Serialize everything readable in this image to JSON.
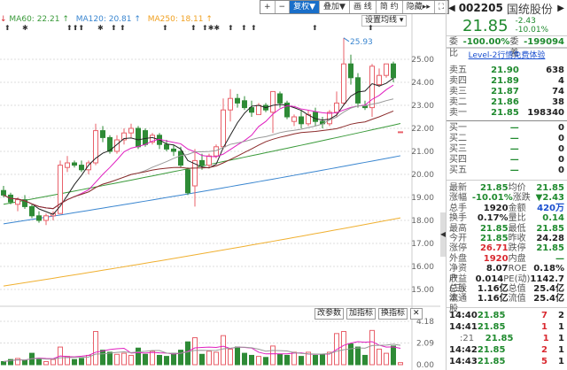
{
  "toolbar": {
    "buttons": [
      "+",
      "−",
      "复权▼",
      "叠加▼",
      "画 线",
      "简 约",
      "隐藏▸▸",
      "⛶"
    ],
    "active": 2
  },
  "ma_legend": [
    {
      "label": "MA60: 22.21 ↑",
      "color": "#3a9a3a"
    },
    {
      "label": "MA120: 20.81 ↑",
      "color": "#3a86d0"
    },
    {
      "label": "MA250: 18.11 ↑",
      "color": "#f0a020"
    }
  ],
  "set_ma_label": "设置均线 ▾",
  "event_markers": [
    "⬆",
    "✱",
    "⬆⬆⬆",
    "✱",
    "⬆",
    "⬆",
    "⬆",
    "⬆",
    "⬆✱✱",
    "⬆",
    "⬆",
    "⬆",
    "⬆",
    "⬆"
  ],
  "indicator_buttons": [
    "改参数",
    "加指标",
    "换指标",
    "✕"
  ],
  "colors": {
    "up": "#e8606a",
    "down": "#2e8b36",
    "ma5": "#222222",
    "ma10": "#e020c0",
    "ma20": "#999999",
    "ma30": "#8b2a2a",
    "ma60": "#3a9a3a",
    "ma120": "#3a86d0",
    "ma250": "#f0b030"
  },
  "chart_data": {
    "type": "candlestick",
    "price_ticks": [
      "25.00",
      "24.00",
      "23.00",
      "22.00",
      "21.00",
      "20.00",
      "19.00",
      "18.00",
      "17.00",
      "16.00",
      "15.00"
    ],
    "volume_ticks": [
      "4.18",
      "2.09",
      "0.00"
    ],
    "high_annotation": "25.93",
    "ohlc": [
      [
        19.3,
        19.5,
        19.0,
        19.1
      ],
      [
        19.1,
        19.2,
        18.7,
        18.8
      ],
      [
        18.7,
        19.0,
        18.4,
        18.9
      ],
      [
        18.9,
        19.1,
        18.5,
        18.6
      ],
      [
        18.6,
        18.7,
        18.1,
        18.2
      ],
      [
        18.2,
        18.4,
        17.9,
        18.0
      ],
      [
        18.0,
        18.3,
        17.8,
        18.2
      ],
      [
        18.2,
        18.4,
        18.0,
        18.3
      ],
      [
        18.3,
        20.6,
        18.3,
        20.4
      ],
      [
        20.3,
        20.8,
        20.1,
        20.5
      ],
      [
        20.5,
        20.6,
        20.3,
        20.4
      ],
      [
        20.4,
        20.6,
        20.1,
        20.2
      ],
      [
        20.2,
        20.6,
        20.0,
        20.5
      ],
      [
        20.5,
        22.2,
        20.4,
        21.9
      ],
      [
        21.9,
        22.1,
        21.4,
        21.6
      ],
      [
        21.6,
        21.7,
        20.9,
        21.0
      ],
      [
        21.0,
        21.7,
        20.9,
        21.5
      ],
      [
        21.5,
        22.0,
        21.3,
        21.8
      ],
      [
        21.8,
        22.2,
        21.6,
        22.0
      ],
      [
        22.0,
        22.1,
        21.1,
        21.2
      ],
      [
        21.9,
        22.0,
        21.2,
        21.3
      ],
      [
        21.4,
        21.8,
        21.3,
        21.7
      ],
      [
        21.7,
        21.8,
        21.1,
        21.3
      ],
      [
        21.3,
        21.5,
        21.0,
        21.1
      ],
      [
        21.1,
        21.3,
        20.8,
        21.0
      ],
      [
        21.0,
        21.2,
        20.3,
        20.4
      ],
      [
        20.2,
        20.3,
        19.1,
        19.2
      ],
      [
        19.5,
        21.1,
        18.6,
        20.6
      ],
      [
        20.6,
        20.9,
        20.2,
        20.4
      ],
      [
        20.4,
        20.9,
        20.3,
        20.8
      ],
      [
        20.8,
        21.3,
        20.7,
        21.2
      ],
      [
        21.2,
        23.3,
        21.1,
        22.8
      ],
      [
        22.8,
        23.7,
        22.3,
        23.3
      ],
      [
        23.3,
        23.5,
        22.9,
        23.1
      ],
      [
        23.2,
        23.4,
        22.8,
        22.9
      ],
      [
        22.9,
        23.2,
        22.5,
        22.7
      ],
      [
        22.6,
        23.1,
        22.6,
        23.0
      ],
      [
        23.0,
        23.1,
        22.7,
        22.8
      ],
      [
        22.7,
        23.6,
        21.8,
        23.6
      ],
      [
        23.5,
        23.6,
        22.9,
        23.1
      ],
      [
        23.1,
        23.2,
        22.4,
        22.5
      ],
      [
        22.3,
        22.6,
        22.1,
        22.5
      ],
      [
        22.5,
        22.8,
        22.0,
        22.2
      ],
      [
        22.2,
        22.8,
        22.1,
        22.6
      ],
      [
        22.7,
        22.9,
        22.1,
        22.3
      ],
      [
        22.3,
        22.5,
        22.0,
        22.2
      ],
      [
        22.2,
        22.8,
        22.1,
        22.7
      ],
      [
        22.7,
        23.6,
        22.5,
        23.1
      ],
      [
        23.1,
        25.93,
        23.0,
        24.8
      ],
      [
        24.8,
        25.2,
        23.9,
        24.2
      ],
      [
        24.2,
        24.4,
        22.9,
        23.1
      ],
      [
        23.0,
        23.2,
        22.8,
        22.9
      ],
      [
        22.9,
        24.8,
        22.5,
        24.7
      ],
      [
        23.9,
        24.6,
        23.8,
        24.3
      ],
      [
        24.3,
        24.8,
        24.2,
        24.8
      ],
      [
        24.8,
        24.9,
        24.0,
        24.2
      ],
      [
        21.85,
        21.85,
        21.85,
        21.85
      ]
    ],
    "volume": [
      0.3,
      0.5,
      0.6,
      0.4,
      1.1,
      0.6,
      0.3,
      0.5,
      1.7,
      0.8,
      0.5,
      0.6,
      0.9,
      3.2,
      1.4,
      1.2,
      1.0,
      1.1,
      0.9,
      1.6,
      1.0,
      1.3,
      0.9,
      0.8,
      1.1,
      1.4,
      2.2,
      2.6,
      1.0,
      1.3,
      1.2,
      2.8,
      1.5,
      1.7,
      1.1,
      0.9,
      0.8,
      0.7,
      1.8,
      1.0,
      0.9,
      1.2,
      0.8,
      1.2,
      0.9,
      1.0,
      1.2,
      3.0,
      3.2,
      2.0,
      1.7,
      0.9,
      3.3,
      1.5,
      1.1,
      1.8,
      0.2
    ],
    "long_ma": {
      "ma60": [
        18.7,
        22.21
      ],
      "ma120": [
        17.85,
        20.81
      ],
      "ma250": [
        15.15,
        18.11
      ]
    },
    "ylim": [
      14.5,
      26.2
    ],
    "vol_lim": [
      0,
      4.18
    ]
  },
  "quote": {
    "code": "002205",
    "name": "国统股份",
    "price": "21.85",
    "change": "-2.43",
    "pct": "-10.01%",
    "wb_label": "委比",
    "wb": "-100.00%",
    "wc_label": "委差",
    "wc": "-199094",
    "level2": "Level-2行情免费体验"
  },
  "asks": [
    {
      "l": "卖五",
      "p": "21.90",
      "v": "638"
    },
    {
      "l": "卖四",
      "p": "21.89",
      "v": "4"
    },
    {
      "l": "卖三",
      "p": "21.87",
      "v": "74"
    },
    {
      "l": "卖二",
      "p": "21.86",
      "v": "38"
    },
    {
      "l": "卖一",
      "p": "21.85",
      "v": "198340"
    }
  ],
  "bids": [
    {
      "l": "买一",
      "p": "—",
      "v": "0"
    },
    {
      "l": "买二",
      "p": "—",
      "v": "0"
    },
    {
      "l": "买三",
      "p": "—",
      "v": "0"
    },
    {
      "l": "买四",
      "p": "—",
      "v": "0"
    },
    {
      "l": "买五",
      "p": "—",
      "v": "0"
    }
  ],
  "stats": [
    [
      "最新",
      "21.85",
      "g",
      "均价",
      "21.85",
      "g"
    ],
    [
      "涨幅",
      "-10.01%",
      "g",
      "涨跌",
      "▼2.43",
      "g"
    ],
    [
      "总手",
      "1920",
      "k",
      "金额",
      "420万",
      "b"
    ],
    [
      "换手",
      "0.17%",
      "k",
      "量比",
      "0.14",
      "g"
    ],
    [
      "最高",
      "21.85",
      "g",
      "最低",
      "21.85",
      "g"
    ],
    [
      "今开",
      "21.85",
      "g",
      "昨收",
      "24.28",
      "k"
    ],
    [
      "涨停",
      "26.71",
      "r",
      "跌停",
      "21.85",
      "g"
    ],
    [
      "外盘",
      "1920",
      "r",
      "内盘",
      "—",
      "g"
    ],
    [
      "净资产",
      "8.07",
      "k",
      "ROE",
      "0.18%",
      "k"
    ],
    [
      "收益(三)",
      "0.014",
      "k",
      "PE(动)",
      "1142.7",
      "k"
    ],
    [
      "总股本",
      "1.16亿",
      "k",
      "总值",
      "25.4亿",
      "k"
    ],
    [
      "流通股",
      "1.16亿",
      "k",
      "流值",
      "25.4亿",
      "k"
    ]
  ],
  "ticks": [
    [
      "14:40",
      "21.85",
      "7",
      "2"
    ],
    [
      "14:41",
      "21.85",
      "1",
      "1"
    ],
    [
      ":21",
      "21.85",
      "1",
      "1"
    ],
    [
      "14:42",
      "21.85",
      "2",
      "1"
    ],
    [
      "14:43",
      "21.85",
      "5",
      "1"
    ]
  ]
}
